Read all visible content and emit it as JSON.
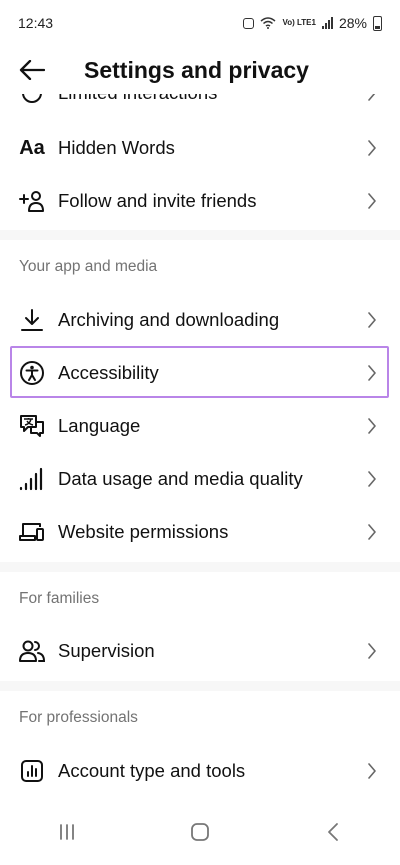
{
  "status": {
    "time": "12:43",
    "battery": "28%",
    "network_label": "Vo) LTE1"
  },
  "header": {
    "title": "Settings and privacy"
  },
  "rows_top": [
    {
      "label": "Limited interactions",
      "icon": "limited-interactions-icon"
    },
    {
      "label": "Hidden Words",
      "icon": "hidden-words-icon",
      "icon_text": "Aa"
    },
    {
      "label": "Follow and invite friends",
      "icon": "add-person-icon"
    }
  ],
  "sections": {
    "app_media": {
      "title": "Your app and media"
    },
    "families": {
      "title": "For families"
    },
    "professionals": {
      "title": "For professionals"
    }
  },
  "rows_app": [
    {
      "label": "Archiving and downloading",
      "icon": "download-icon"
    },
    {
      "label": "Accessibility",
      "icon": "accessibility-icon"
    },
    {
      "label": "Language",
      "icon": "language-icon"
    },
    {
      "label": "Data usage and media quality",
      "icon": "signal-bars-icon"
    },
    {
      "label": "Website permissions",
      "icon": "devices-icon"
    }
  ],
  "rows_family": [
    {
      "label": "Supervision",
      "icon": "supervision-icon"
    }
  ],
  "rows_pro": [
    {
      "label": "Account type and tools",
      "icon": "chart-icon"
    }
  ],
  "colors": {
    "highlight": "#b985e8",
    "section_text": "#737373",
    "divider": "#f7f7f7"
  }
}
